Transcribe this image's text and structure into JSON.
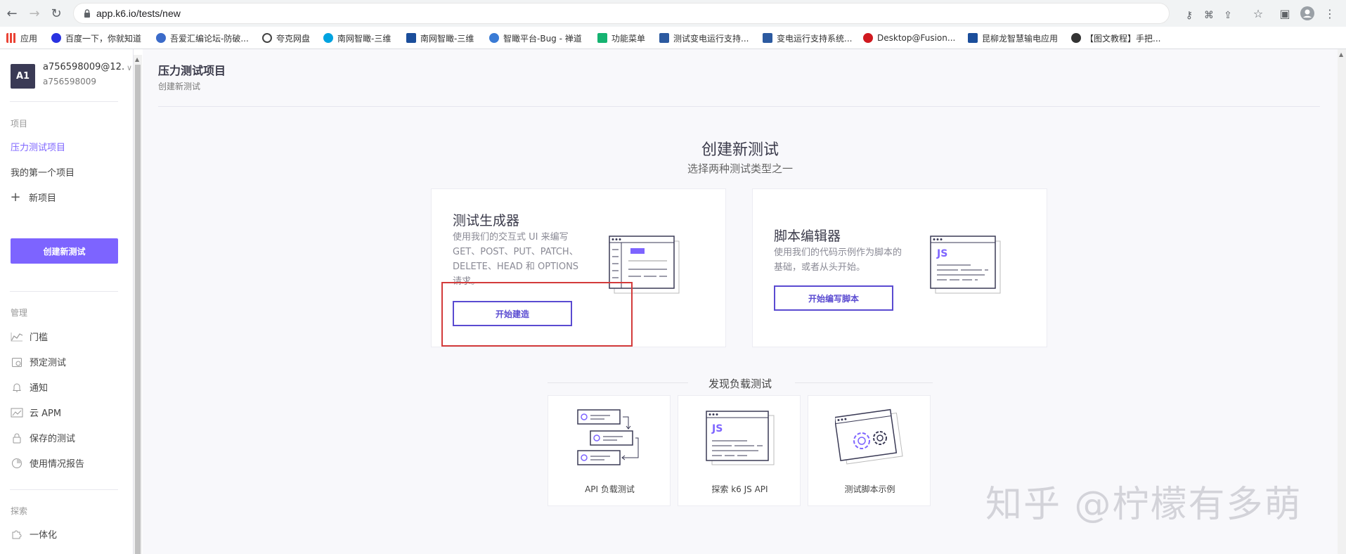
{
  "browser": {
    "url": "app.k6.io/tests/new",
    "bookmarks": [
      {
        "label": "应用",
        "color": "#4285f4"
      },
      {
        "label": "百度一下，你就知道",
        "color": "#2932e1"
      },
      {
        "label": "吾爱汇编论坛-防破...",
        "color": "#3b6bc9"
      },
      {
        "label": "夸克网盘",
        "color": "#444444"
      },
      {
        "label": "南网智瞰-三维",
        "color": "#00a3e0"
      },
      {
        "label": "南网智瞰-三维",
        "color": "#1b4e9b"
      },
      {
        "label": "智瞰平台-Bug - 禅道",
        "color": "#3a7bd5"
      },
      {
        "label": "功能菜单",
        "color": "#15b371"
      },
      {
        "label": "测试变电运行支持...",
        "color": "#2c5aa0"
      },
      {
        "label": "变电运行支持系统...",
        "color": "#2c5aa0"
      },
      {
        "label": "Desktop@Fusion...",
        "color": "#d0191f"
      },
      {
        "label": "昆柳龙智慧输电应用",
        "color": "#1b4e9b"
      },
      {
        "label": "【图文教程】手把...",
        "color": "#333333"
      }
    ]
  },
  "account": {
    "avatar": "A1",
    "name": "a756598009@12...",
    "sub": "a756598009"
  },
  "sidebar": {
    "projects_heading": "项目",
    "projects": [
      {
        "label": "压力测试项目"
      },
      {
        "label": "我的第一个项目"
      },
      {
        "label": "新项目"
      }
    ],
    "create_button": "创建新测试",
    "manage_heading": "管理",
    "manage": [
      {
        "label": "门槛",
        "icon": "chart-icon"
      },
      {
        "label": "预定测试",
        "icon": "calendar-icon"
      },
      {
        "label": "通知",
        "icon": "bell-icon"
      },
      {
        "label": "云 APM",
        "icon": "apm-icon"
      },
      {
        "label": "保存的测试",
        "icon": "lock-icon"
      },
      {
        "label": "使用情况报告",
        "icon": "pie-icon"
      }
    ],
    "explore_heading": "探索",
    "explore": [
      {
        "label": "一体化",
        "icon": "puzzle-icon"
      }
    ]
  },
  "header": {
    "title": "压力测试项目",
    "subtitle": "创建新测试"
  },
  "main": {
    "title": "创建新测试",
    "subtitle": "选择两种测试类型之一",
    "cards": [
      {
        "title": "测试生成器",
        "desc_lines": [
          "使用我们的交互式 UI 来编写",
          "GET、POST、PUT、PATCH、",
          "DELETE、HEAD 和 OPTIONS",
          "请求。"
        ],
        "button": "开始建造"
      },
      {
        "title": "脚本编辑器",
        "desc_lines": [
          "使用我们的代码示例作为脚本的",
          "基础，或者从头开始。"
        ],
        "button": "开始编写脚本",
        "illustration_text": "JS"
      }
    ],
    "discover_title": "发现负载测试",
    "discover": [
      {
        "label": "API 负载测试"
      },
      {
        "label": "探索 k6 JS API",
        "illustration_text": "JS"
      },
      {
        "label": "测试脚本示例"
      }
    ]
  },
  "watermark": "知乎 @柠檬有多萌",
  "colors": {
    "accent": "#7d64ff",
    "button_border": "#5a4bd1",
    "highlight": "#d33b3b"
  }
}
